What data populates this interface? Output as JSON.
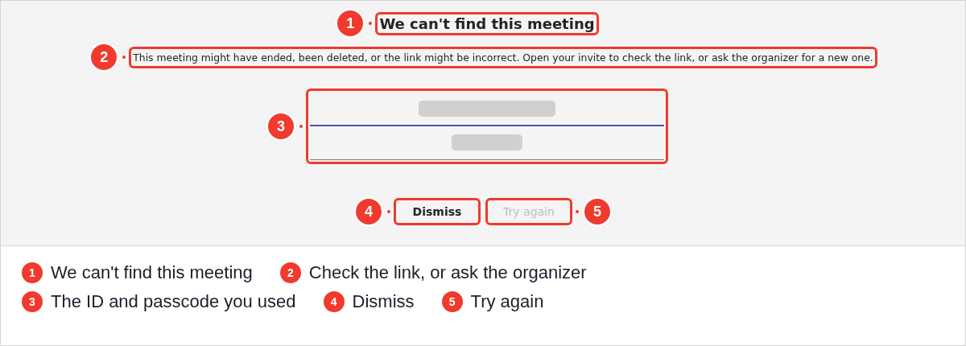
{
  "dialog": {
    "title": {
      "text": "We can't find this meeting",
      "badge": "1"
    },
    "message": {
      "text": "This meeting might have ended, been deleted, or the link might be incorrect. Open your invite to check the link, or ask the organizer for a new one.",
      "badge": "2"
    },
    "fields": {
      "badge": "3",
      "items": [
        {
          "focused": true
        },
        {
          "focused": false
        }
      ]
    },
    "buttons": [
      {
        "label": "Dismiss",
        "disabled": false,
        "badge": "4"
      },
      {
        "label": "Try again",
        "disabled": true,
        "badge": "5"
      }
    ]
  },
  "legend": [
    {
      "number": "1",
      "label": "We can't find this meeting"
    },
    {
      "number": "2",
      "label": "Check the link, or ask the organizer"
    },
    {
      "number": "3",
      "label": "The ID and passcode you used"
    },
    {
      "number": "4",
      "label": "Dismiss"
    },
    {
      "number": "5",
      "label": "Try again"
    }
  ]
}
